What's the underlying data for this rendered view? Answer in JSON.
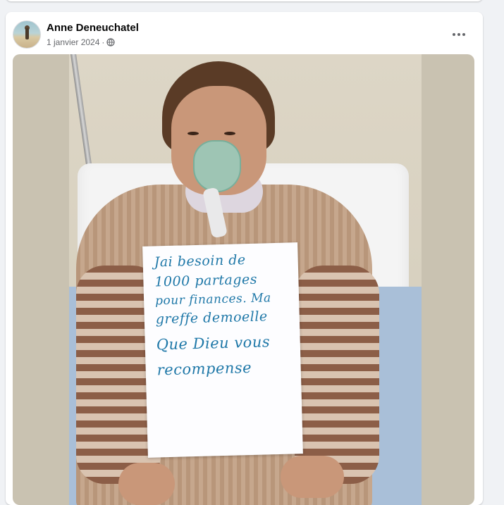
{
  "post": {
    "author": "Anne Deneuchatel",
    "date": "1 janvier 2024",
    "separator": "·",
    "audience_icon": "globe-icon",
    "more_icon": "more-horizontal-icon"
  },
  "photo": {
    "sign_lines": [
      "Jai besoin de",
      "1000 partages",
      "pour finances. Ma",
      "greffe demoelle",
      "Que Dieu vous",
      "recompense"
    ]
  },
  "colors": {
    "page_bg": "#f0f2f5",
    "card_bg": "#ffffff",
    "secondary_text": "#65676b",
    "sign_ink": "#1f78a8"
  }
}
